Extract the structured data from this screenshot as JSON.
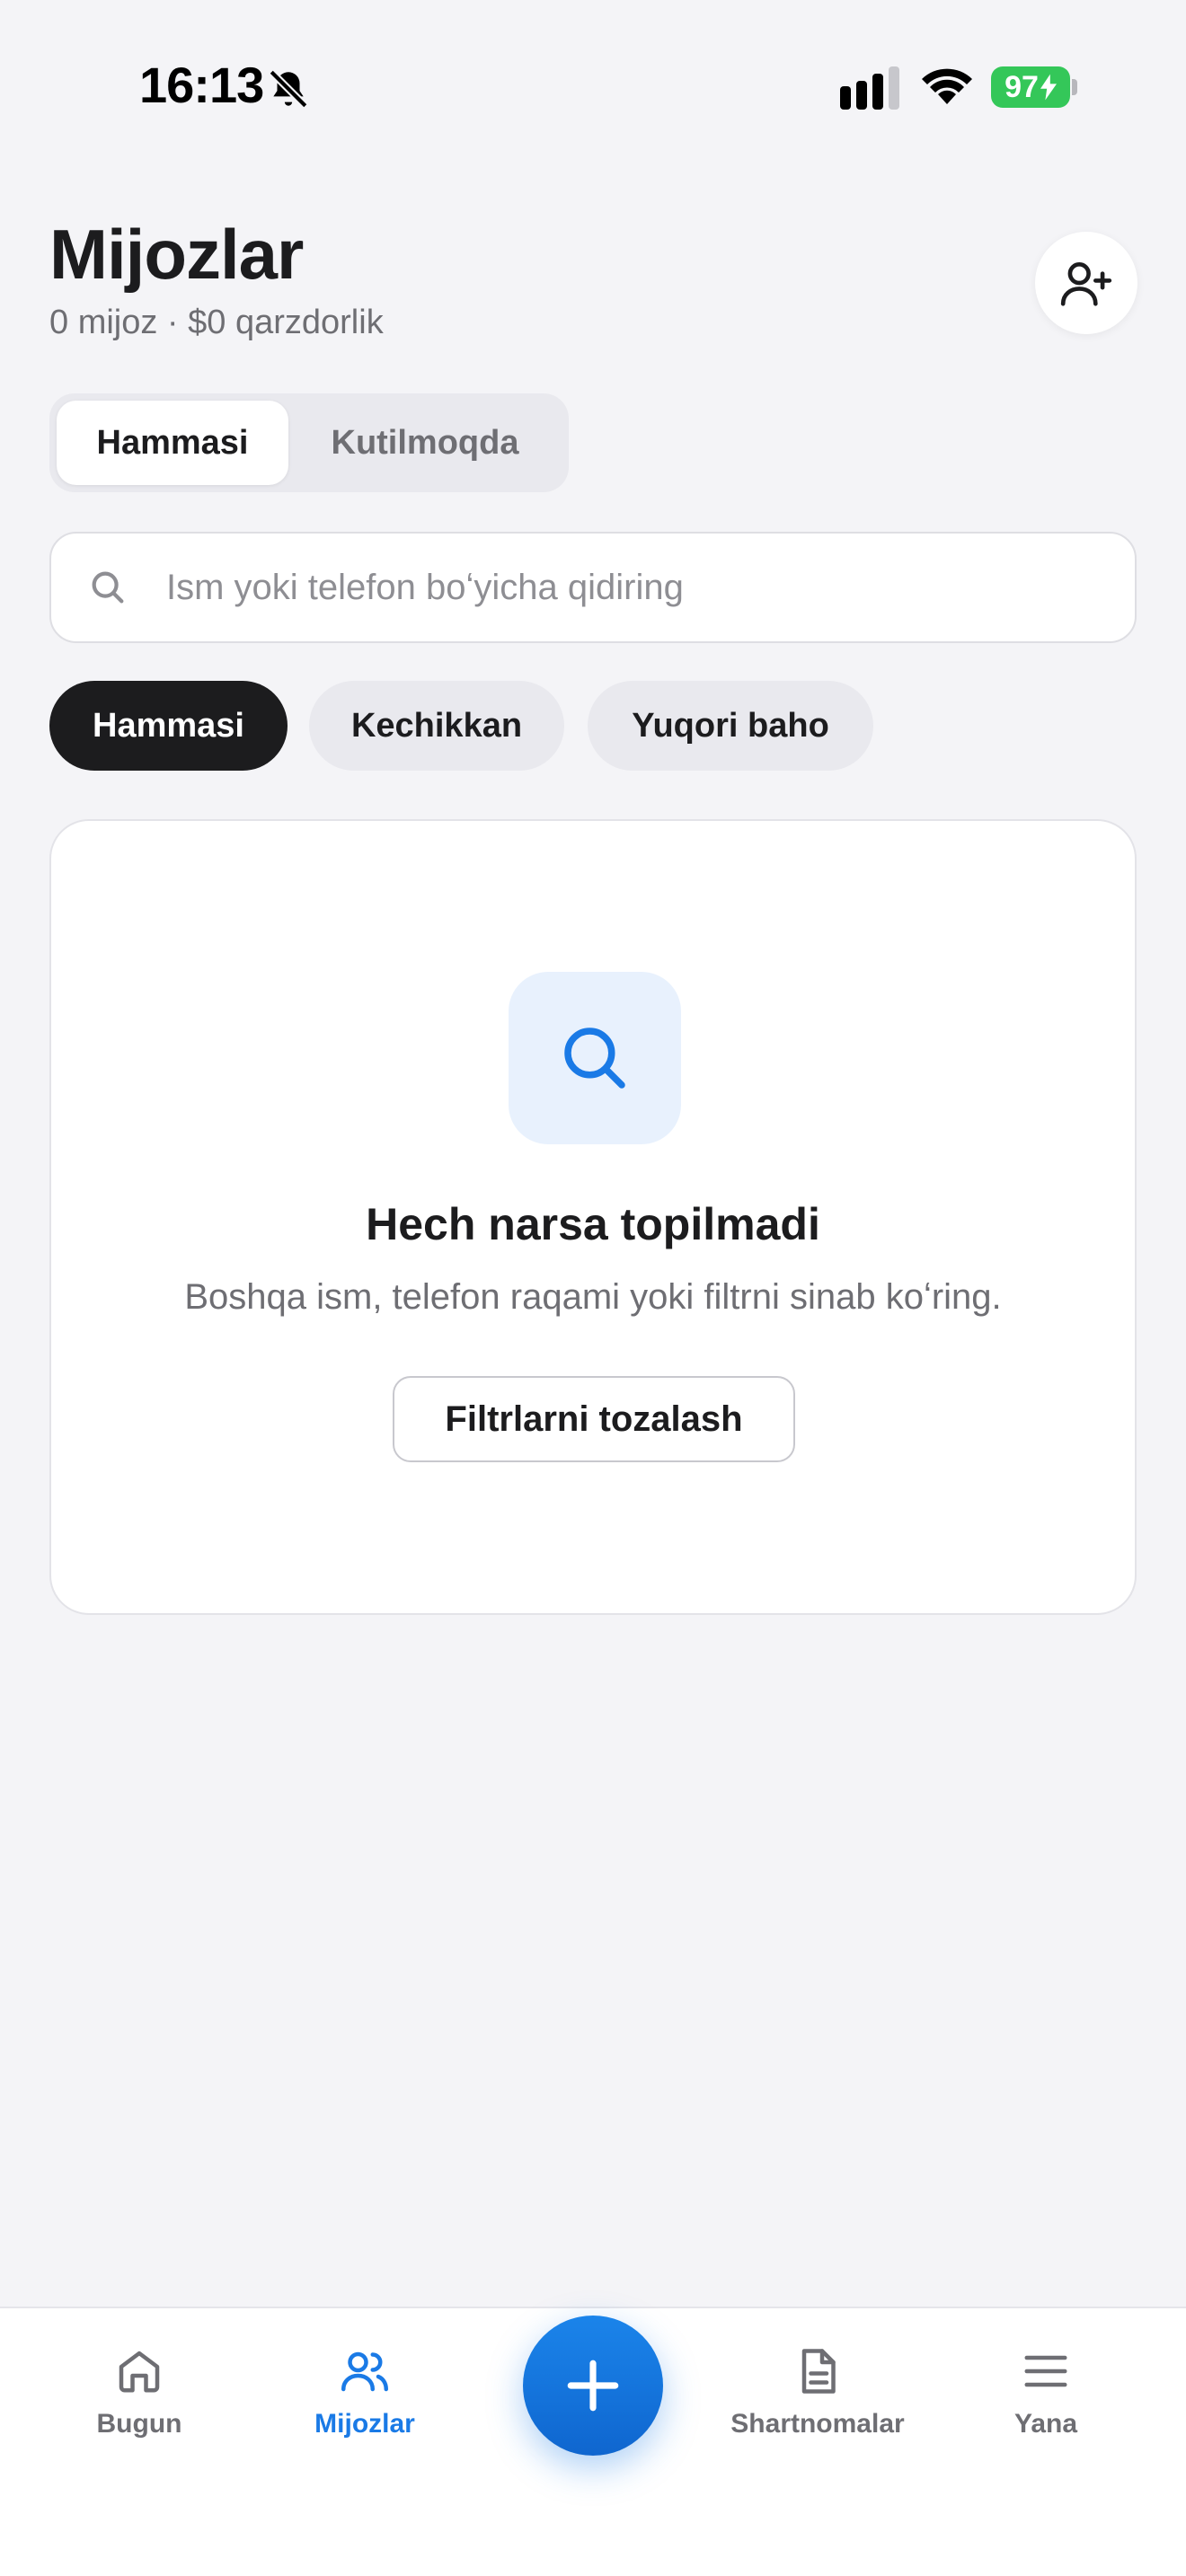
{
  "status_bar": {
    "time": "16:13",
    "battery": "97",
    "icons": [
      "bell-off-icon",
      "signal-icon",
      "wifi-icon",
      "battery-icon"
    ]
  },
  "header": {
    "title": "Mijozlar",
    "subtitle": "0 mijoz · $0 qarzdorlik",
    "add_icon": "user-plus-icon"
  },
  "segments": [
    {
      "label": "Hammasi",
      "active": true
    },
    {
      "label": "Kutilmoqda",
      "active": false
    }
  ],
  "search": {
    "placeholder": "Ism yoki telefon boʻyicha qidiring",
    "value": ""
  },
  "chips": [
    {
      "label": "Hammasi",
      "active": true
    },
    {
      "label": "Kechikkan",
      "active": false
    },
    {
      "label": "Yuqori baho",
      "active": false
    }
  ],
  "empty_state": {
    "icon": "search-icon",
    "title": "Hech narsa topilmadi",
    "description": "Boshqa ism, telefon raqami yoki filtrni sinab koʻring.",
    "button_label": "Filtrlarni tozalash"
  },
  "tab_bar": {
    "tabs": [
      {
        "label": "Bugun",
        "icon": "home-icon",
        "active": false
      },
      {
        "label": "Mijozlar",
        "icon": "users-icon",
        "active": true
      },
      {
        "label": "Shartnomalar",
        "icon": "document-icon",
        "active": false
      },
      {
        "label": "Yana",
        "icon": "menu-icon",
        "active": false
      }
    ],
    "fab_icon": "plus-icon"
  },
  "colors": {
    "accent": "#1a7ae6",
    "background": "#f4f4f7",
    "chip_active": "#1c1c1e",
    "battery": "#34c759"
  }
}
